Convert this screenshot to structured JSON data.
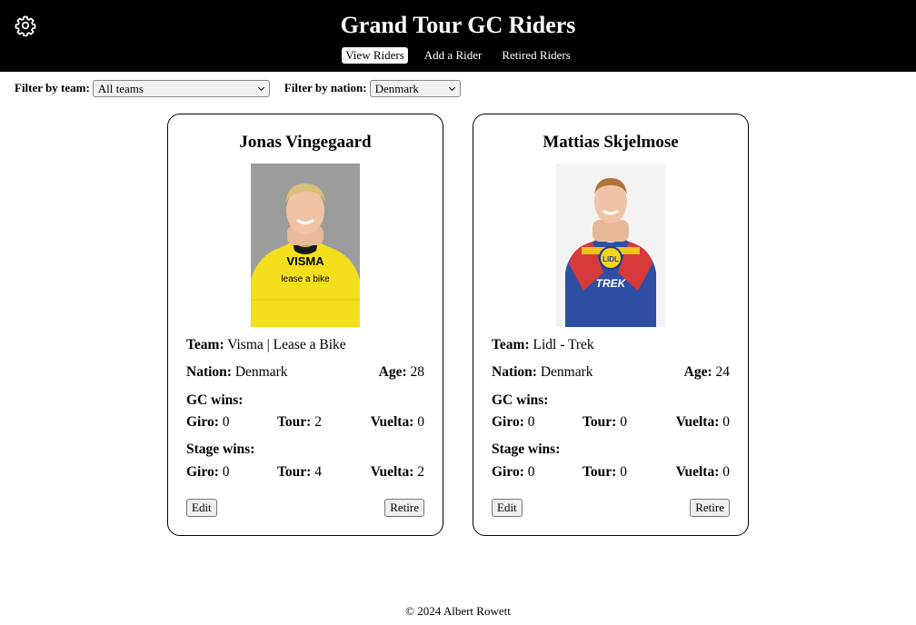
{
  "header": {
    "title": "Grand Tour GC Riders",
    "settings_icon": "gear-icon",
    "nav": [
      {
        "label": "View Riders",
        "active": true
      },
      {
        "label": "Add a Rider",
        "active": false
      },
      {
        "label": "Retired Riders",
        "active": false
      }
    ]
  },
  "filters": {
    "team_label": "Filter by team:",
    "team_value": "All teams",
    "nation_label": "Filter by nation:",
    "nation_value": "Denmark"
  },
  "riders": [
    {
      "name": "Jonas Vingegaard",
      "team_label": "Team:",
      "team": "Visma | Lease a Bike",
      "nation_label": "Nation:",
      "nation": "Denmark",
      "age_label": "Age:",
      "age": "28",
      "gc_heading": "GC wins:",
      "gc": {
        "giro": "0",
        "tour": "2",
        "vuelta": "0"
      },
      "stage_heading": "Stage wins:",
      "stage": {
        "giro": "0",
        "tour": "4",
        "vuelta": "2"
      },
      "edit_label": "Edit",
      "retire_label": "Retire",
      "jersey_color": "#f5e11e",
      "jersey_text_1": "VISMA",
      "jersey_text_2": "lease a bike"
    },
    {
      "name": "Mattias Skjelmose",
      "team_label": "Team:",
      "team": "Lidl - Trek",
      "nation_label": "Nation:",
      "nation": "Denmark",
      "age_label": "Age:",
      "age": "24",
      "gc_heading": "GC wins:",
      "gc": {
        "giro": "0",
        "tour": "0",
        "vuelta": "0"
      },
      "stage_heading": "Stage wins:",
      "stage": {
        "giro": "0",
        "tour": "0",
        "vuelta": "0"
      },
      "edit_label": "Edit",
      "retire_label": "Retire",
      "jersey_color": "#2b4a9c",
      "jersey_text_1": "LIDL",
      "jersey_text_2": "TREK"
    }
  ],
  "stat_labels": {
    "giro": "Giro:",
    "tour": "Tour:",
    "vuelta": "Vuelta:"
  },
  "footer": {
    "text": "© 2024 Albert Rowett"
  }
}
